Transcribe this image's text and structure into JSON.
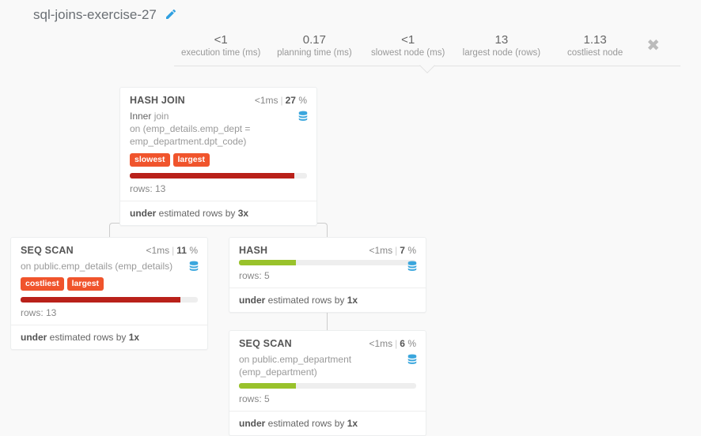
{
  "title": "sql-joins-exercise-27",
  "stats": [
    {
      "val": "<1",
      "lbl": "execution time (ms)"
    },
    {
      "val": "0.17",
      "lbl": "planning time (ms)"
    },
    {
      "val": "<1",
      "lbl": "slowest node (ms)"
    },
    {
      "val": "13",
      "lbl": "largest node (rows)"
    },
    {
      "val": "1.13",
      "lbl": "costliest node"
    }
  ],
  "nodes": {
    "hashjoin": {
      "title": "HASH JOIN",
      "time": "<1ms",
      "pct": "27",
      "descPre": "Inner ",
      "descJoin": "join",
      "descOn": "on (emp_details.emp_dept = emp_department.dpt_code)",
      "tags": [
        "slowest",
        "largest"
      ],
      "barWidth": "93%",
      "rows": "rows: 13",
      "estPre": "under",
      "estMid": " estimated rows by ",
      "estVal": "3x"
    },
    "seqscan1": {
      "title": "SEQ SCAN",
      "time": "<1ms",
      "pct": "11",
      "descOn": "on public.emp_details (emp_details)",
      "tags": [
        "costliest",
        "largest"
      ],
      "barWidth": "90%",
      "rows": "rows: 13",
      "estPre": "under",
      "estMid": " estimated rows by ",
      "estVal": "1x"
    },
    "hash": {
      "title": "HASH",
      "time": "<1ms",
      "pct": "7",
      "barWidth": "32%",
      "rows": "rows: 5",
      "estPre": "under",
      "estMid": " estimated rows by ",
      "estVal": "1x"
    },
    "seqscan2": {
      "title": "SEQ SCAN",
      "time": "<1ms",
      "pct": "6",
      "descOn": "on public.emp_department (emp_department)",
      "barWidth": "32%",
      "rows": "rows: 5",
      "estPre": "under",
      "estMid": " estimated rows by ",
      "estVal": "1x"
    }
  },
  "pctSuffix": " %"
}
